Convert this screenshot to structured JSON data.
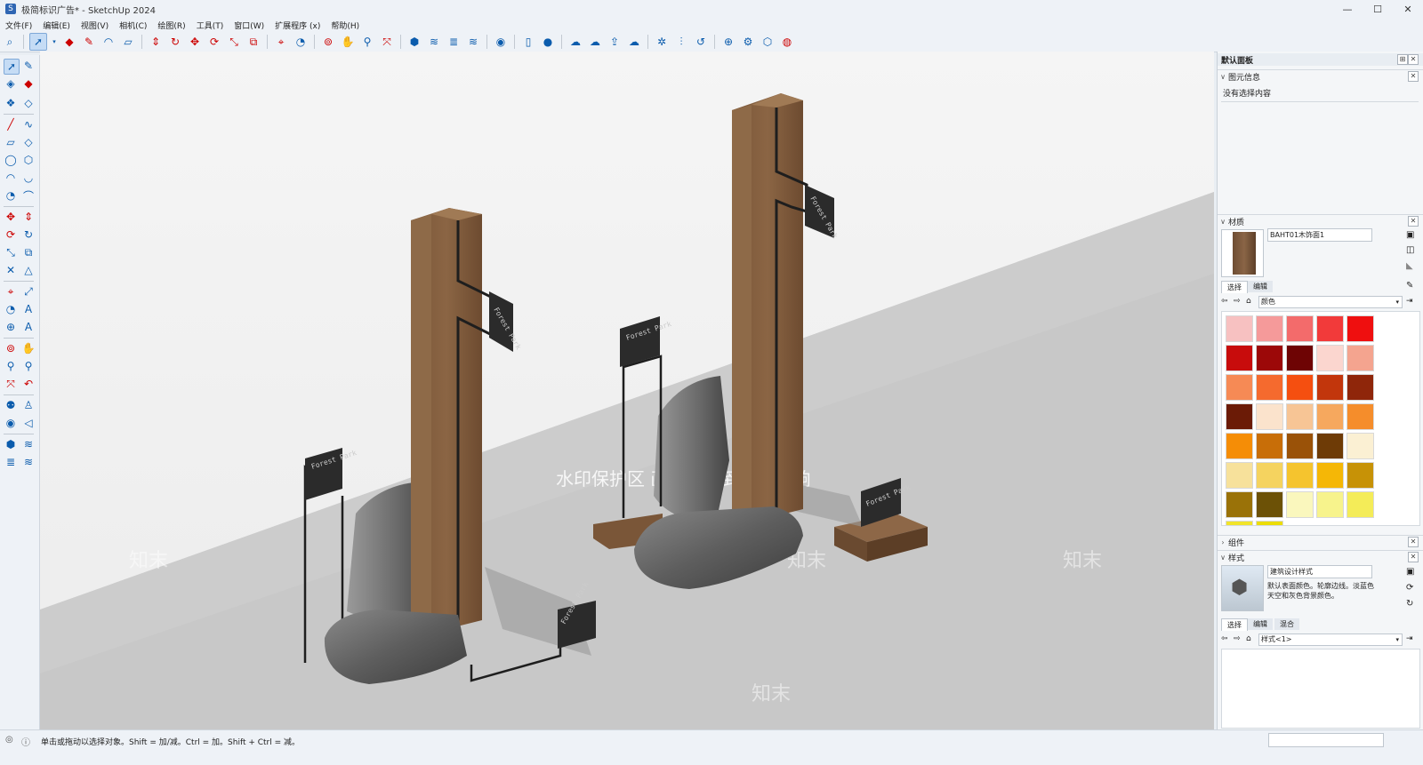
{
  "window": {
    "title": "极简标识广告* - SketchUp 2024",
    "controls": {
      "minimize": "—",
      "maximize": "☐",
      "close": "✕"
    }
  },
  "menu": [
    "文件(F)",
    "编辑(E)",
    "视图(V)",
    "相机(C)",
    "绘图(R)",
    "工具(T)",
    "窗口(W)",
    "扩展程序 (x)",
    "帮助(H)"
  ],
  "toolbar_icons": [
    "search-icon",
    "select-icon",
    "eraser-icon",
    "pencil-icon",
    "arc-icon",
    "shape-icon",
    "pushpull-icon",
    "followme-icon",
    "move-icon",
    "rotate-icon",
    "scale-icon",
    "offset-icon",
    "tape-icon",
    "protractor-icon",
    "orbit-icon",
    "pan-icon",
    "zoom-icon",
    "zoom-extents-icon",
    "section-icon",
    "warehouse-icon",
    "extension-icon",
    "profile-icon",
    "new-file-icon",
    "user-icon",
    "cloud-icon",
    "sync-icon",
    "upload-icon",
    "download-icon",
    "settings-icon",
    "adjust-icon",
    "refresh-icon",
    "import-icon",
    "gear-icon",
    "chrome-icon"
  ],
  "viewport": {
    "watermark": "水印保护区  画质会受到部分影响",
    "watermark_tile": "知末",
    "sign_text": "Forest Park"
  },
  "right_panel": {
    "title": "默认面板",
    "entity_info": {
      "header": "图元信息",
      "empty_text": "没有选择内容"
    },
    "materials": {
      "header": "材质",
      "material_name": "BAHT01木饰面1",
      "tabs": [
        "选择",
        "编辑"
      ],
      "library": "颜色",
      "swatch_colors": [
        "#f7c1c1",
        "#f59a9a",
        "#f36b6b",
        "#f23a3a",
        "#ef0f0f",
        "#c80c0c",
        "#9c0808",
        "#6e0404",
        "#fbd6cf",
        "#f4a48f",
        "#f68a55",
        "#f56a2e",
        "#f54f10",
        "#c2360c",
        "#8f260a",
        "#6b1b06",
        "#fbe3cc",
        "#f7c595",
        "#f6a85e",
        "#f58d2b",
        "#f58d06",
        "#c86e08",
        "#9a5208",
        "#6e3b06",
        "#fbf0d3",
        "#f7e19b",
        "#f5d35f",
        "#f5c42e",
        "#f5b706",
        "#c79206",
        "#9a7208",
        "#6c5106",
        "#faf7bd",
        "#f7f38c",
        "#f4ec58",
        "#f1e42a",
        "#ecdd06"
      ]
    },
    "components": {
      "header": "组件"
    },
    "styles": {
      "header": "样式",
      "style_name": "建筑设计样式",
      "description": "默认表面颜色。轮廓边线。淡蓝色天空和灰色背景颜色。",
      "tabs": [
        "选择",
        "编辑",
        "混合"
      ],
      "library": "样式<1>"
    }
  },
  "status": {
    "hint": "单击或拖动以选择对象。Shift = 加/减。Ctrl = 加。Shift + Ctrl = 减。"
  }
}
